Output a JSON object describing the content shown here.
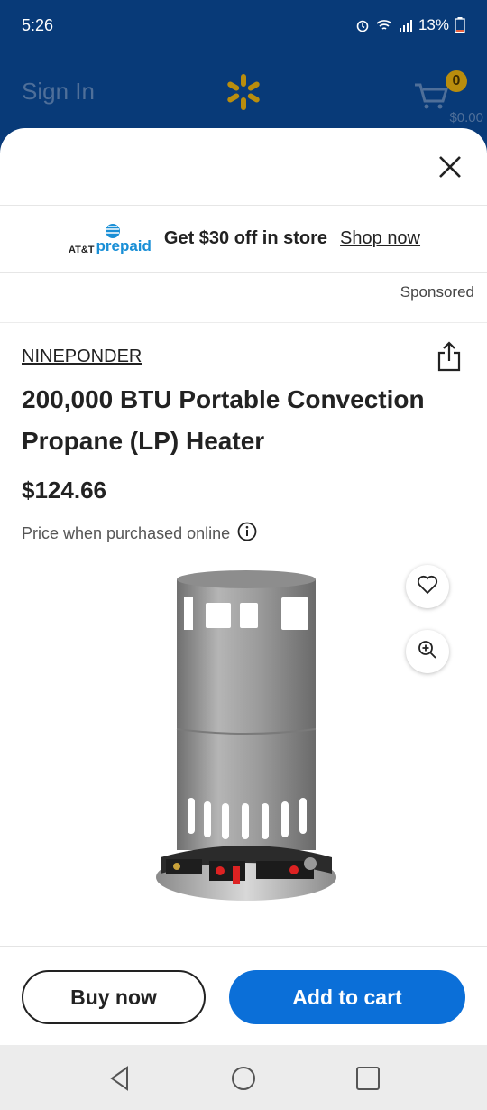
{
  "status": {
    "time": "5:26",
    "battery": "13%"
  },
  "header": {
    "sign_in": "Sign In",
    "cart_count": "0",
    "cart_total": "$0.00"
  },
  "ad": {
    "brand_small": "AT&T",
    "brand_large": "prepaid",
    "text": "Get $30 off in store",
    "link": "Shop now",
    "sponsored": "Sponsored"
  },
  "product": {
    "brand": "NINEPONDER",
    "title": "200,000 BTU Portable Convection Propane (LP) Heater",
    "price": "$124.66",
    "price_note": "Price when purchased online"
  },
  "actions": {
    "buy_now": "Buy now",
    "add_to_cart": "Add to cart"
  },
  "icons": [
    "alarm-icon",
    "wifi-icon",
    "signal-icon",
    "battery-icon",
    "spark-logo-icon",
    "cart-icon",
    "close-icon",
    "share-icon",
    "info-icon",
    "heart-icon",
    "zoom-icon",
    "back-icon",
    "home-icon",
    "recents-icon"
  ],
  "colors": {
    "header_bg": "#083a78",
    "primary": "#0b6fd8",
    "att_blue": "#1a8fd6",
    "spark": "#b98d0d"
  }
}
